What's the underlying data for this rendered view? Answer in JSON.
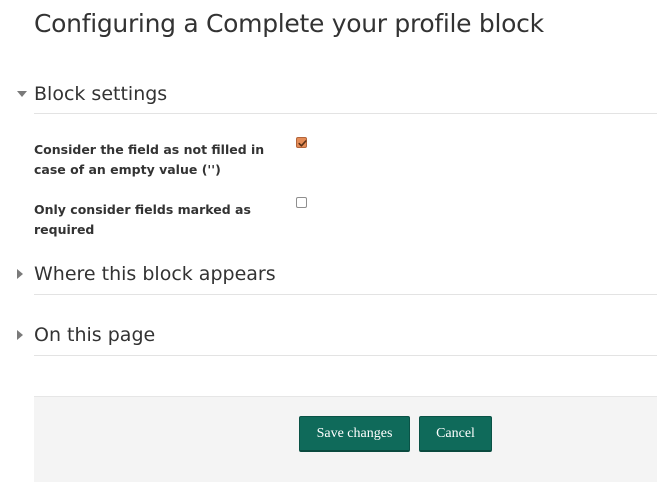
{
  "page": {
    "title": "Configuring a Complete your profile block"
  },
  "sections": {
    "block_settings": {
      "label": "Block settings",
      "expanded": true,
      "fields": {
        "empty_value": {
          "label": "Consider the field as not filled in case of an empty value ('')",
          "checked": true
        },
        "required_only": {
          "label": "Only consider fields marked as required",
          "checked": false
        }
      }
    },
    "where_appears": {
      "label": "Where this block appears",
      "expanded": false
    },
    "on_this_page": {
      "label": "On this page",
      "expanded": false
    }
  },
  "actions": {
    "save_label": "Save changes",
    "cancel_label": "Cancel"
  },
  "colors": {
    "primary_button": "#0f6a5a",
    "checkbox_checked": "#e48c57",
    "footer_background": "#f4f4f4"
  },
  "icons": {
    "expanded": "caret-down-icon",
    "collapsed": "caret-right-icon",
    "checked": "checkmark-icon"
  }
}
